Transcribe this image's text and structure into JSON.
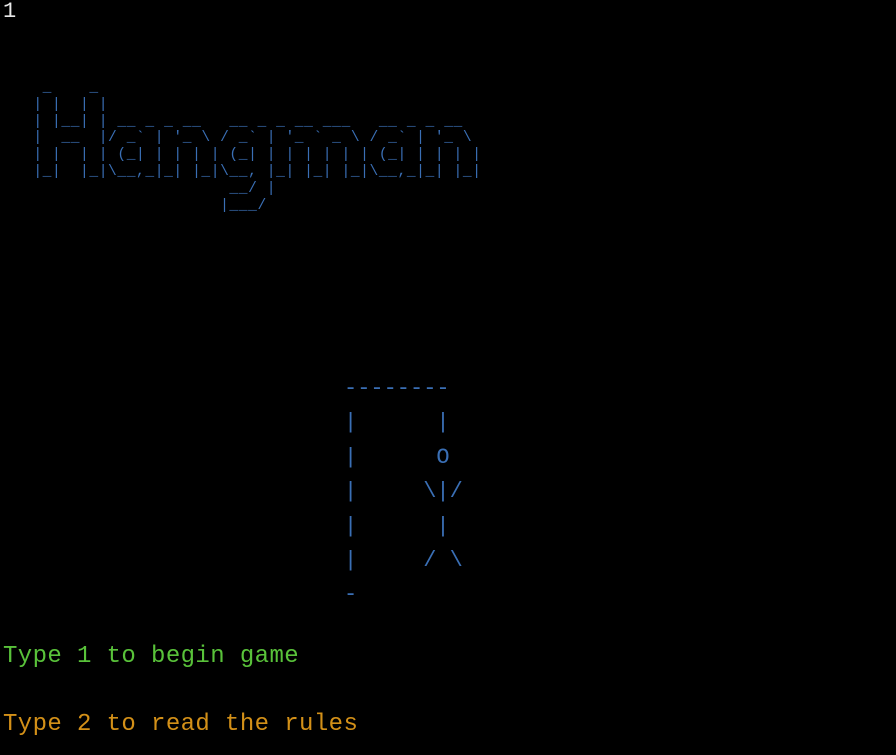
{
  "terminal": {
    "input_echo": "1",
    "title_art": "  _    _\n | |  | |\n | |__| | __ _ _ __   __ _ _ __ ___   __ _ _ __\n |  __  |/ _` | '_ \\ / _` | '_ ` _ \\ / _` | '_ \\\n | |  | | (_| | | | | (_| | | | | | | (_| | | | |\n |_|  |_|\\__,_|_| |_|\\__, |_| |_| |_|\\__,_|_| |_|\n                      __/ |\n                     |___/",
    "gallows_art": "--------\n|      |\n|      O\n|     \\|/\n|      |\n|     / \\\n-",
    "menu": {
      "start_game": "Type 1 to begin game",
      "read_rules": "Type 2 to read the rules"
    }
  },
  "colors": {
    "background": "#000000",
    "ascii_art": "#3a6fb5",
    "start_option": "#59c23a",
    "rules_option": "#d39018",
    "input_echo": "#e8e8e8"
  }
}
